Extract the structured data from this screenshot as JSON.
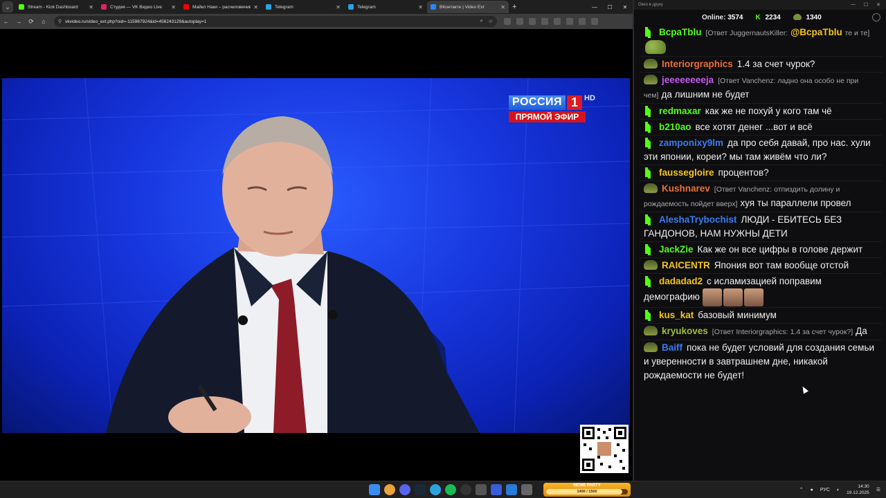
{
  "browser": {
    "tabs": [
      {
        "title": "Stream - Kick Dashboard",
        "color": "#53fc18",
        "active": false
      },
      {
        "title": "Студия — VK Видео Live",
        "color": "#e0245e",
        "active": false
      },
      {
        "title": "Майкл Наки – расчеловечиван",
        "color": "#ff0000",
        "active": false
      },
      {
        "title": "Telegram",
        "color": "#2aa3e0",
        "active": false
      },
      {
        "title": "Telegram",
        "color": "#2aa3e0",
        "active": false
      },
      {
        "title": "ВКонтакте | Video Ext",
        "color": "#2787f5",
        "active": true
      }
    ],
    "url": "vkvideo.ru/video_ext.php?oid=-115987924&id=456243129&autoplay=1"
  },
  "video": {
    "channel_name": "РОССИЯ",
    "channel_number": "1",
    "hd_label": "HD",
    "live_label": "ПРЯМОЙ ЭФИР"
  },
  "chat": {
    "window_title": "Окно в друку",
    "online_label": "Online:",
    "online_count": "3574",
    "kick_count": "2234",
    "pepe_count": "1340",
    "messages": [
      {
        "user": "ВсраТblu",
        "color": "#53fc18",
        "badge": "kick",
        "reply": "[Ответ JuggernautsKiller:",
        "mention": "@ВсраТblu",
        "reply_tail": "те и те]",
        "text": "",
        "emote": "frog"
      },
      {
        "user": "Interiorgraphics",
        "color": "#e8703a",
        "badge": "pepe",
        "reply": "",
        "text": "1.4 за счет чурок?"
      },
      {
        "user": "jeeeeeeeeja",
        "color": "#c55bf0",
        "badge": "pepe",
        "reply": "[Ответ Vanchenz: ладно она особо не при чем]",
        "text": "да лишним не будет"
      },
      {
        "user": "redmaxar",
        "color": "#53fc18",
        "badge": "kick",
        "reply": "",
        "text": "как же не похуй у кого там чё"
      },
      {
        "user": "b210ao",
        "color": "#53fc18",
        "badge": "kick",
        "reply": "",
        "text": "все хотят денег ...вот и всё"
      },
      {
        "user": "zamponixy9lm",
        "color": "#3a7bf2",
        "badge": "kick",
        "reply": "",
        "text": "да про себя давай, про нас. хули эти японии, кореи? мы там живём что ли?"
      },
      {
        "user": "fausseglоire",
        "color": "#f5c518",
        "badge": "kick",
        "reply": "",
        "text": "процентов?"
      },
      {
        "user": "Kushnarev",
        "color": "#e8703a",
        "badge": "pepe",
        "reply": "[Ответ Vanchenz: отпиздить долину и рождаемость пойдет вверх]",
        "text": "хуя ты параллели провел"
      },
      {
        "user": "AleshaTrybochist",
        "color": "#3a7bf2",
        "badge": "kick",
        "reply": "",
        "text": "ЛЮДИ - ЕБИТЕСЬ БЕЗ ГАНДОНОВ, НАМ НУЖНЫ ДЕТИ"
      },
      {
        "user": "JackZie",
        "color": "#53fc18",
        "badge": "kick",
        "reply": "",
        "text": "Как же он все цифры в голове держит"
      },
      {
        "user": "RAICENTR",
        "color": "#f5c518",
        "badge": "pepe",
        "reply": "",
        "text": "Япония вот там вообще отстой"
      },
      {
        "user": "dadadad2",
        "color": "#f5c518",
        "badge": "kick",
        "reply": "",
        "text": "с исламизацией поправим демографию",
        "emote": "faces"
      },
      {
        "user": "kus_kat",
        "color": "#f5c518",
        "badge": "kick",
        "reply": "",
        "text": "базовый минимум"
      },
      {
        "user": "kryukoves",
        "color": "#9bbf3a",
        "badge": "pepe",
        "reply": "[Ответ Interiorgraphics: 1.4 за счет чурок?]",
        "text": "Да"
      },
      {
        "user": "Baiff",
        "color": "#3a7bf2",
        "badge": "pepe",
        "reply": "",
        "text": "пока не будет условий для создания семьи и уверенности в завтрашнем дне, никакой рождаемости не будет!"
      }
    ]
  },
  "taskbar": {
    "meme_title": "MEME PARTY",
    "meme_progress": "1400 / 1500",
    "meme_fraction": 0.93,
    "lang": "РУС",
    "time": "14:30",
    "date": "19.12.2025"
  }
}
